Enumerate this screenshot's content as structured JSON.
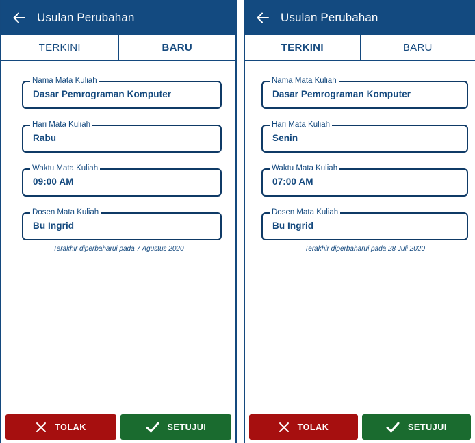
{
  "screens": [
    {
      "appbar": {
        "title": "Usulan Perubahan"
      },
      "tabs": [
        {
          "label": "TERKINI",
          "active": false
        },
        {
          "label": "BARU",
          "active": true
        }
      ],
      "fields": [
        {
          "label": "Nama Mata Kuliah",
          "value": "Dasar Pemrograman Komputer"
        },
        {
          "label": "Hari Mata Kuliah",
          "value": "Rabu"
        },
        {
          "label": "Waktu Mata Kuliah",
          "value": "09:00 AM"
        },
        {
          "label": "Dosen Mata Kuliah",
          "value": "Bu Ingrid"
        }
      ],
      "updated_text": "Terakhir diperbaharui pada 7 Agustus 2020",
      "actions": {
        "reject_label": "TOLAK",
        "approve_label": "SETUJUI"
      }
    },
    {
      "appbar": {
        "title": "Usulan Perubahan"
      },
      "tabs": [
        {
          "label": "TERKINI",
          "active": true
        },
        {
          "label": "BARU",
          "active": false
        }
      ],
      "fields": [
        {
          "label": "Nama Mata Kuliah",
          "value": "Dasar Pemrograman Komputer"
        },
        {
          "label": "Hari Mata Kuliah",
          "value": "Senin"
        },
        {
          "label": "Waktu Mata Kuliah",
          "value": "07:00 AM"
        },
        {
          "label": "Dosen Mata Kuliah",
          "value": "Bu Ingrid"
        }
      ],
      "updated_text": "Terakhir diperbaharui pada 28 Juli 2020",
      "actions": {
        "reject_label": "TOLAK",
        "approve_label": "SETUJUI"
      }
    }
  ],
  "icons": {
    "back": "arrow-left-icon",
    "reject": "close-icon",
    "approve": "checkmark-icon"
  },
  "colors": {
    "primary": "#134a80",
    "reject": "#a60f0f",
    "approve": "#1a6b2f",
    "background": "#ffffff"
  }
}
